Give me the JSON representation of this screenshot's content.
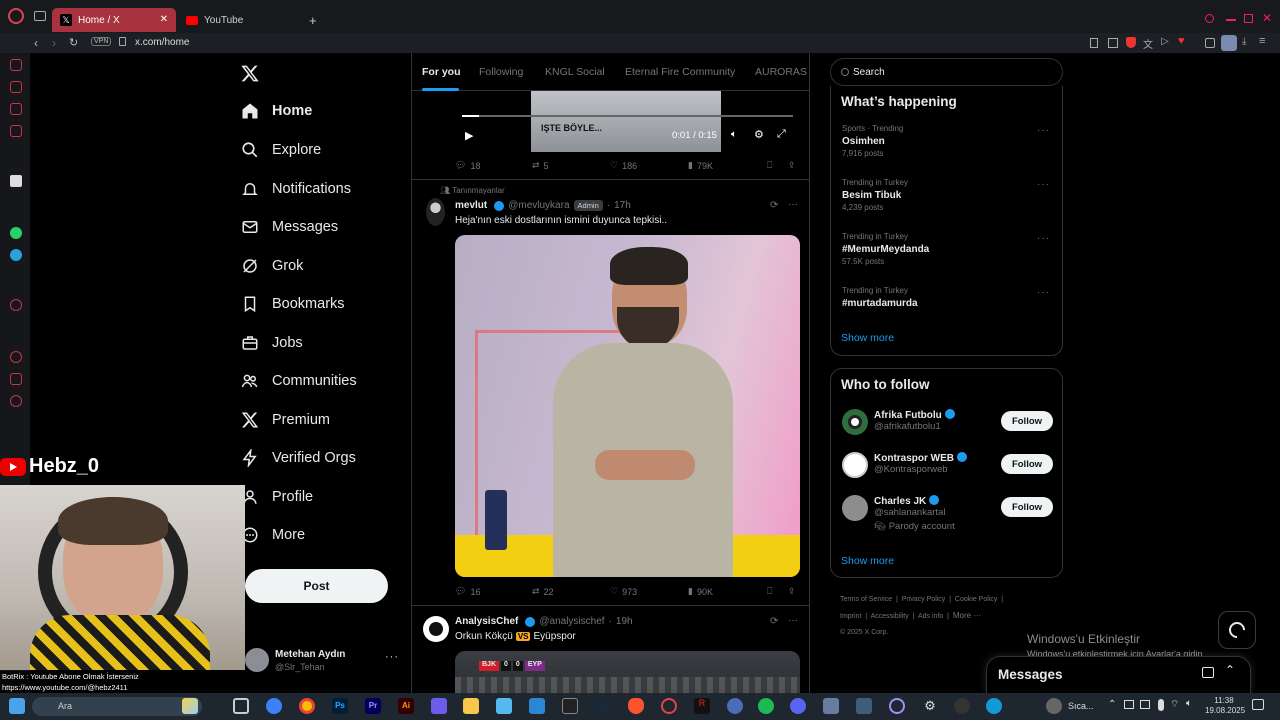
{
  "browser": {
    "tabs": [
      {
        "label": "Home / X",
        "active": true
      },
      {
        "label": "YouTube",
        "active": false
      }
    ],
    "new_tab": "+",
    "url": "x.com/home",
    "vpn": "VPN"
  },
  "nav": {
    "items": [
      {
        "label": "Home",
        "icon": "home-icon"
      },
      {
        "label": "Explore",
        "icon": "search-icon"
      },
      {
        "label": "Notifications",
        "icon": "bell-icon"
      },
      {
        "label": "Messages",
        "icon": "envelope-icon"
      },
      {
        "label": "Grok",
        "icon": "grok-icon"
      },
      {
        "label": "Bookmarks",
        "icon": "bookmark-icon"
      },
      {
        "label": "Jobs",
        "icon": "briefcase-icon"
      },
      {
        "label": "Communities",
        "icon": "people-icon"
      },
      {
        "label": "Premium",
        "icon": "x-icon"
      },
      {
        "label": "Verified Orgs",
        "icon": "lightning-icon"
      },
      {
        "label": "Profile",
        "icon": "person-icon"
      },
      {
        "label": "More",
        "icon": "more-circle-icon"
      }
    ],
    "post_button": "Post",
    "account": {
      "name": "Metehan Aydın",
      "handle": "@Slr_Tehan"
    }
  },
  "feed": {
    "tabs": [
      "For you",
      "Following",
      "KNGL Social",
      "Eternal Fire Community",
      "AURORAS"
    ],
    "video1": {
      "caption": "IŞTE BÖYLE...",
      "time": "0:01 / 0:15"
    },
    "tweet1_actions": {
      "replies": "18",
      "reposts": "5",
      "likes": "186",
      "views": "79K"
    },
    "tweet2": {
      "context": "Tanınmayanlar",
      "name": "mevlut",
      "handle": "@mevluykara",
      "badge": "Admin",
      "time": "17h",
      "text": "Heja'nın eski dostlarının ismini duyunca tepkisi..",
      "actions": {
        "replies": "16",
        "reposts": "22",
        "likes": "973",
        "views": "90K"
      }
    },
    "tweet3": {
      "name": "AnalysisChef",
      "handle": "@analysischef",
      "time": "19h",
      "text_a": "Orkun Kökçü",
      "vs": "VS",
      "text_b": "Eyüpspor",
      "score_left": "0",
      "score_right": "0",
      "team_left": "BJK",
      "team_right": "EYP"
    }
  },
  "right": {
    "search_placeholder": "Search",
    "whats_happening": "What’s happening",
    "trends": [
      {
        "context": "Sports · Trending",
        "name": "Osimhen",
        "posts": "7,916 posts"
      },
      {
        "context": "Trending in Turkey",
        "name": "Besim Tibuk",
        "posts": "4,239 posts"
      },
      {
        "context": "Trending in Turkey",
        "name": "#MemurMeydanda",
        "posts": "57.5K posts"
      },
      {
        "context": "Trending in Turkey",
        "name": "#murtadamurda",
        "posts": ""
      }
    ],
    "show_more": "Show more",
    "who_to_follow": "Who to follow",
    "follow_label": "Follow",
    "suggestions": [
      {
        "name": "Afrika Futbolu",
        "handle": "@afrikafutbolu1",
        "extra": ""
      },
      {
        "name": "Kontraspor WEB",
        "handle": "@Kontrasporweb",
        "extra": ""
      },
      {
        "name": "Charles JK",
        "handle": "@sahlanankartal",
        "extra": "Parody account"
      }
    ],
    "footer": [
      "Terms of Service",
      "Privacy Policy",
      "Cookie Policy",
      "Imprint",
      "Accessibility",
      "Ads info",
      "More ···",
      "© 2025 X Corp."
    ],
    "messages_drawer": "Messages"
  },
  "overlay": {
    "channel": "Hebz_0",
    "chat_line1": "BotRix : Youtube Abone Olmak İsterseniz",
    "chat_line2": "https://www.youtube.com/@hebz2411",
    "watermark_title": "Windows'u Etkinleştir",
    "watermark_sub": "Windows'u etkinleştirmek için Ayarlar'a gidin."
  },
  "taskbar": {
    "search": "Ara",
    "weather": "Sıca...",
    "time": "11:38",
    "date": "19.08.2025"
  },
  "colors": {
    "accent": "#1d9bf0",
    "bg": "#000000",
    "border": "#2f3336",
    "muted": "#71767b"
  }
}
